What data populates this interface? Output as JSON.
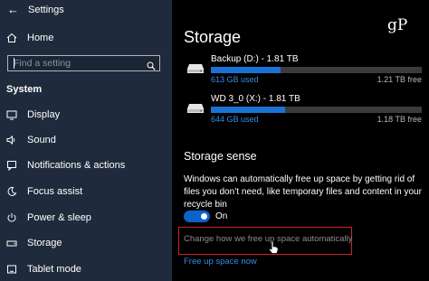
{
  "window": {
    "title": "Settings"
  },
  "sidebar": {
    "home_label": "Home",
    "search_placeholder": "Find a setting",
    "section_label": "System",
    "items": [
      {
        "label": "Display",
        "icon": "monitor-icon"
      },
      {
        "label": "Sound",
        "icon": "speaker-icon"
      },
      {
        "label": "Notifications & actions",
        "icon": "notifications-icon"
      },
      {
        "label": "Focus assist",
        "icon": "moon-icon"
      },
      {
        "label": "Power & sleep",
        "icon": "power-icon"
      },
      {
        "label": "Storage",
        "icon": "storage-drive-icon"
      },
      {
        "label": "Tablet mode",
        "icon": "tablet-icon"
      }
    ]
  },
  "main": {
    "title": "Storage",
    "drives": [
      {
        "name": "Backup (D:) - 1.81 TB",
        "used": "613 GB used",
        "free": "1.21 TB free",
        "used_fraction": 0.33
      },
      {
        "name": "WD 3_0 (X:) - 1.81 TB",
        "used": "644 GB used",
        "free": "1.18 TB free",
        "used_fraction": 0.35
      }
    ],
    "storage_sense": {
      "title": "Storage sense",
      "description": "Windows can automatically free up space by getting rid of files you don’t need, like temporary files and content in your recycle bin",
      "toggle_state": "On",
      "change_link": "Change how we free up space automatically",
      "free_now_link": "Free up space now"
    }
  },
  "logo_text": "gP",
  "colors": {
    "accent": "#1a73d4",
    "link": "#2f8fe8",
    "sidebar_bg": "#1f2b3c",
    "highlight": "#c8242c"
  }
}
